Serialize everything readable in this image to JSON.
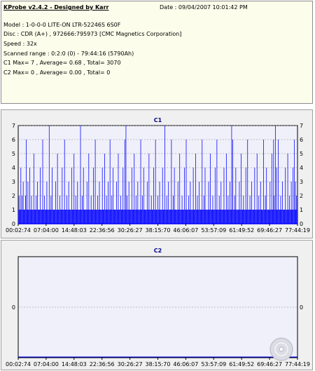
{
  "info": {
    "app_title": "KProbe v2.4.2 - Designed by Karr",
    "date_text": "Date : 09/04/2007 10:01:42 PM",
    "lines": [
      "Model : 1-0-0-0 LITE-ON LTR-52246S       6S0F",
      "Disc : CDR (A+) , 972666:795973 [CMC Magnetics Corporation]",
      "Speed : 32x",
      "Scanned range : 0:2:0 (0) - 79:44:16 (5790Ah)",
      "C1 Max= 7 , Average= 0.68 , Total= 3070",
      "C2 Max= 0 , Average= 0.00 , Total= 0"
    ]
  },
  "colors": {
    "plot_bg": "#f0f0fa",
    "series": "#0000ff",
    "grid": "#8c8c8c",
    "title": "#00008c"
  },
  "chart_data": [
    {
      "type": "bar",
      "title": "C1",
      "ylim": [
        0,
        7
      ],
      "yticks": [
        0,
        1,
        2,
        3,
        4,
        5,
        6,
        7
      ],
      "xlim_seconds": [
        0,
        4784.2
      ],
      "xtick_labels": [
        "00:02:74",
        "07:04:00",
        "14:48:03",
        "22:36:56",
        "30:26:27",
        "38:15:70",
        "46:06:07",
        "53:57:09",
        "61:49:52",
        "69:46:27",
        "77:44:19"
      ],
      "grid": true,
      "summary": {
        "max": 7,
        "average": 0.68,
        "total": 3070
      },
      "sample_minutes_count": 80,
      "values": [
        1,
        2,
        1,
        1,
        4,
        1,
        2,
        1,
        3,
        1,
        1,
        1,
        2,
        6,
        1,
        1,
        3,
        1,
        1,
        4,
        1,
        1,
        2,
        1,
        1,
        1,
        5,
        1,
        1,
        1,
        2,
        1,
        3,
        1,
        1,
        1,
        1,
        4,
        1,
        1,
        1,
        6,
        1,
        1,
        2,
        1,
        1,
        1,
        3,
        1,
        1,
        1,
        7,
        1,
        1,
        2,
        1,
        4,
        1,
        1,
        1,
        1,
        1,
        3,
        1,
        1,
        5,
        1,
        1,
        1,
        2,
        1,
        1,
        1,
        4,
        1,
        1,
        1,
        6,
        1,
        1,
        1,
        2,
        1,
        1,
        3,
        1,
        1,
        1,
        1,
        4,
        1,
        1,
        1,
        5,
        1,
        1,
        2,
        1,
        1,
        3,
        1,
        1,
        1,
        1,
        7,
        1,
        1,
        2,
        1,
        4,
        1,
        1,
        1,
        1,
        1,
        3,
        1,
        1,
        5,
        1,
        1,
        1,
        2,
        1,
        1,
        1,
        4,
        1,
        1,
        6,
        1,
        1,
        1,
        2,
        1,
        1,
        3,
        1,
        1,
        1,
        1,
        4,
        1,
        1,
        1,
        5,
        1,
        1,
        2,
        1,
        1,
        3,
        1,
        1,
        6,
        1,
        1,
        2,
        1,
        4,
        1,
        1,
        1,
        1,
        1,
        3,
        1,
        1,
        5,
        1,
        1,
        1,
        2,
        1,
        1,
        1,
        4,
        1,
        1,
        6,
        1,
        7,
        1,
        2,
        1,
        1,
        3,
        1,
        1,
        1,
        1,
        4,
        1,
        1,
        1,
        5,
        1,
        1,
        2,
        1,
        1,
        3,
        1,
        1,
        1,
        1,
        6,
        1,
        1,
        2,
        1,
        4,
        1,
        1,
        1,
        1,
        1,
        3,
        1,
        1,
        5,
        1,
        1,
        1,
        2,
        1,
        1,
        1,
        4,
        1,
        1,
        6,
        1,
        1,
        1,
        2,
        1,
        1,
        3,
        1,
        1,
        1,
        1,
        4,
        1,
        1,
        1,
        7,
        1,
        1,
        2,
        1,
        1,
        3,
        1,
        1,
        1,
        1,
        6,
        1,
        1,
        2,
        1,
        4,
        1,
        1,
        1,
        1,
        1,
        3,
        1,
        1,
        5,
        1,
        1,
        1,
        2,
        1,
        1,
        1,
        4,
        1,
        1,
        6,
        1,
        1,
        1,
        2,
        1,
        1,
        3,
        1,
        1,
        1,
        1,
        4,
        1,
        1,
        1,
        5,
        1,
        1,
        2,
        1,
        1,
        3,
        1,
        1,
        1,
        1,
        6,
        1,
        1,
        2,
        1,
        4,
        1,
        1,
        1,
        1,
        1,
        3,
        1,
        1,
        5,
        1,
        1,
        1,
        2,
        1,
        1,
        1,
        4,
        1,
        1,
        6,
        1,
        1,
        1,
        2,
        1,
        1,
        3,
        1,
        1,
        1,
        1,
        4,
        1,
        1,
        1,
        5,
        1,
        1,
        2,
        1,
        1,
        3,
        1,
        1,
        7,
        1,
        6,
        1,
        1,
        2,
        1,
        4,
        1,
        1,
        1,
        1,
        1,
        3,
        1,
        1,
        5,
        1,
        1,
        1,
        2,
        1,
        1,
        1,
        4,
        1,
        1,
        6,
        1,
        1,
        1,
        2,
        1,
        1,
        3,
        1,
        1,
        1,
        1,
        4,
        1,
        1,
        1,
        5,
        1,
        1,
        2,
        1,
        1,
        3,
        1,
        1,
        1,
        1,
        6,
        1,
        1,
        2,
        1,
        4,
        1,
        1,
        1,
        1,
        1,
        3,
        1,
        1,
        5,
        1,
        1,
        6,
        2,
        1,
        7,
        1,
        4,
        1,
        1,
        6,
        1,
        1,
        1,
        2,
        1,
        1,
        3,
        1,
        1,
        1,
        1,
        4,
        1,
        1,
        1,
        5,
        1,
        1,
        2,
        1,
        1,
        3,
        1,
        1,
        4,
        1,
        6,
        1,
        3,
        1,
        2,
        1
      ]
    },
    {
      "type": "line",
      "title": "C2",
      "yticks": [
        0
      ],
      "xlim_seconds": [
        0,
        4784.2
      ],
      "xtick_labels": [
        "00:02:74",
        "07:04:00",
        "14:48:03",
        "22:36:56",
        "30:26:27",
        "38:15:70",
        "46:06:07",
        "53:57:09",
        "61:49:52",
        "69:46:27",
        "77:44:19"
      ],
      "grid": true,
      "summary": {
        "max": 0,
        "average": 0.0,
        "total": 0
      },
      "values": [
        0,
        0
      ]
    }
  ]
}
